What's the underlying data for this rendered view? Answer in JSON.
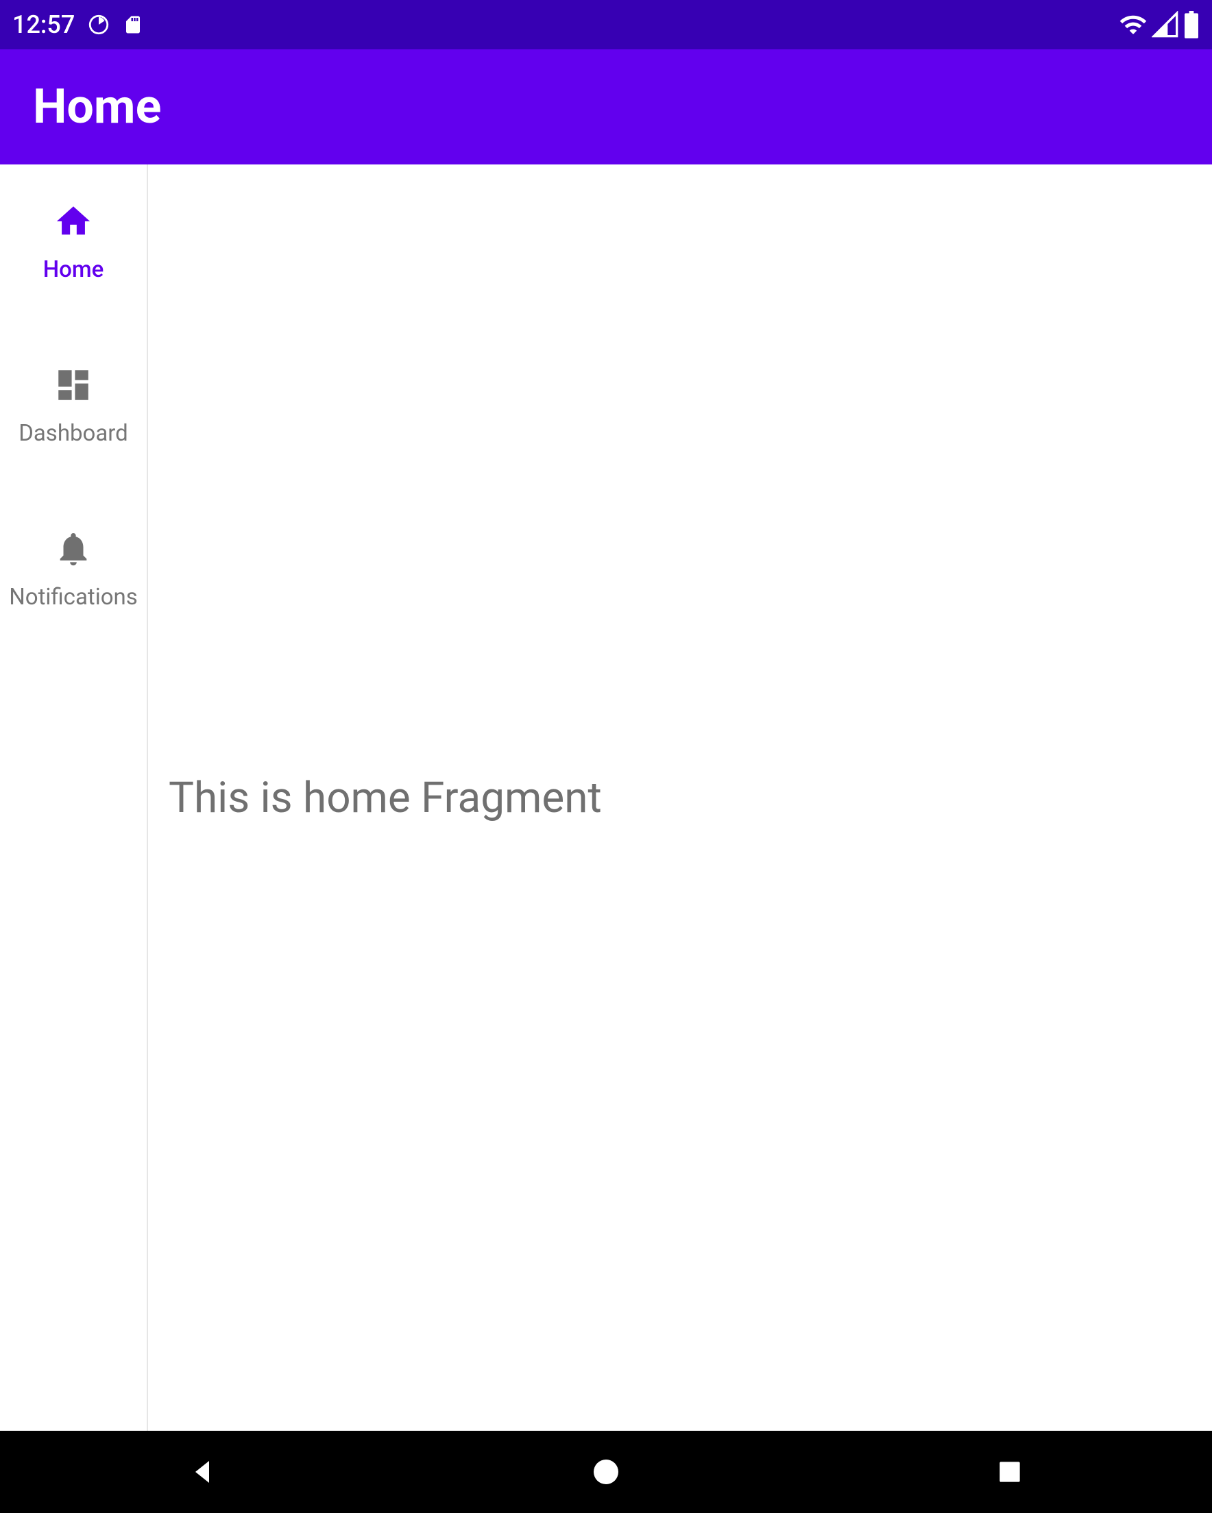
{
  "status": {
    "time": "12:57"
  },
  "appbar": {
    "title": "Home"
  },
  "nav": {
    "items": [
      {
        "label": "Home",
        "icon": "home",
        "active": true
      },
      {
        "label": "Dashboard",
        "icon": "dashboard",
        "active": false
      },
      {
        "label": "Notifications",
        "icon": "notifications",
        "active": false
      }
    ]
  },
  "content": {
    "text": "This is home Fragment"
  },
  "colors": {
    "primary": "#6200ee",
    "primaryDark": "#3700b3",
    "inactive": "#707070"
  }
}
